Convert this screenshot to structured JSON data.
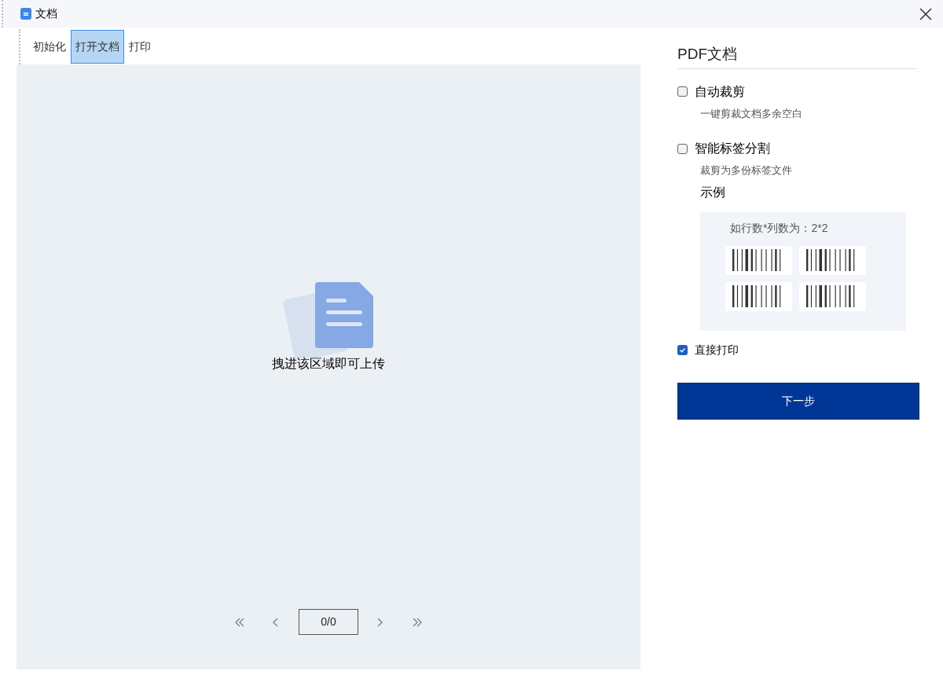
{
  "window": {
    "title": "文档"
  },
  "tabs": [
    {
      "label": "初始化",
      "selected": false
    },
    {
      "label": "打开文档",
      "selected": true
    },
    {
      "label": "打印",
      "selected": false
    }
  ],
  "drop_zone": {
    "hint": "拽进该区域即可上传"
  },
  "pager": {
    "page": "0/0"
  },
  "panel": {
    "title": "PDF文档",
    "options": [
      {
        "label": "自动裁剪",
        "checked": false,
        "description": "一键剪裁文档多余空白"
      },
      {
        "label": "智能标签分割",
        "checked": false,
        "description": "裁剪为多份标签文件",
        "example": {
          "title": "示例",
          "caption": "如行数*列数为：2*2"
        }
      },
      {
        "label": "直接打印",
        "checked": true
      }
    ],
    "next_button": "下一步"
  }
}
